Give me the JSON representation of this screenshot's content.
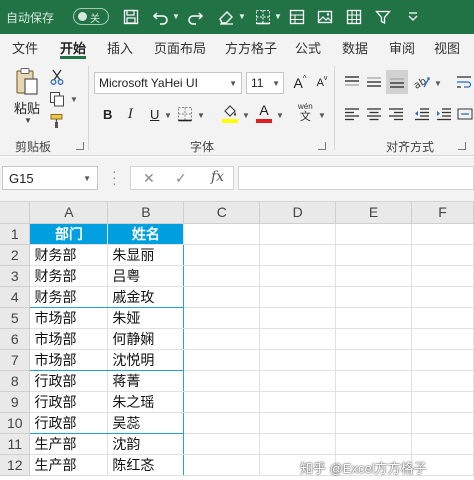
{
  "titlebar": {
    "autosave_label": "自动保存",
    "toggle_state": "关",
    "icons": [
      "save-icon",
      "undo-icon",
      "redo-icon",
      "eraser-icon",
      "borders-icon",
      "table-icon",
      "image-icon",
      "grid-icon",
      "filter-icon"
    ],
    "accent": "#217346"
  },
  "tabs": [
    {
      "label": "文件"
    },
    {
      "label": "开始",
      "active": true
    },
    {
      "label": "插入"
    },
    {
      "label": "页面布局"
    },
    {
      "label": "方方格子"
    },
    {
      "label": "公式"
    },
    {
      "label": "数据"
    },
    {
      "label": "审阅"
    },
    {
      "label": "视图"
    }
  ],
  "ribbon": {
    "clipboard": {
      "paste_label": "粘贴",
      "group_label": "剪贴板"
    },
    "font": {
      "font_name": "Microsoft YaHei UI",
      "font_size": "11",
      "bold": "B",
      "italic": "I",
      "underline": "U",
      "font_color_glyph": "A",
      "grow_glyph": "A",
      "shrink_glyph": "A",
      "wen_top": "wén",
      "wen_bottom": "文",
      "group_label": "字体",
      "highlight_color": "#ffff00",
      "font_color": "#e02020"
    },
    "alignment": {
      "group_label": "对齐方式"
    }
  },
  "formula_bar": {
    "name_box": "G15",
    "cancel_glyph": "✕",
    "enter_glyph": "✓",
    "fx_label": "fx",
    "content": ""
  },
  "sheet": {
    "columns": [
      "A",
      "B",
      "C",
      "D",
      "E",
      "F"
    ],
    "header_row": {
      "row": "1",
      "a": "部门",
      "b": "姓名"
    },
    "header_color": "#00a0e0",
    "rows": [
      {
        "row": "2",
        "a": "财务部",
        "b": "朱显丽"
      },
      {
        "row": "3",
        "a": "财务部",
        "b": "吕粤"
      },
      {
        "row": "4",
        "a": "财务部",
        "b": "戚金玫"
      },
      {
        "row": "5",
        "a": "市场部",
        "b": "朱娅"
      },
      {
        "row": "6",
        "a": "市场部",
        "b": "何静娴"
      },
      {
        "row": "7",
        "a": "市场部",
        "b": "沈悦明"
      },
      {
        "row": "8",
        "a": "行政部",
        "b": "蒋菁"
      },
      {
        "row": "9",
        "a": "行政部",
        "b": "朱之瑶"
      },
      {
        "row": "10",
        "a": "行政部",
        "b": "吴蕊"
      },
      {
        "row": "11",
        "a": "生产部",
        "b": "沈韵"
      },
      {
        "row": "12",
        "a": "生产部",
        "b": "陈红忞"
      }
    ]
  },
  "watermark": "知乎 @Excel方方格子"
}
